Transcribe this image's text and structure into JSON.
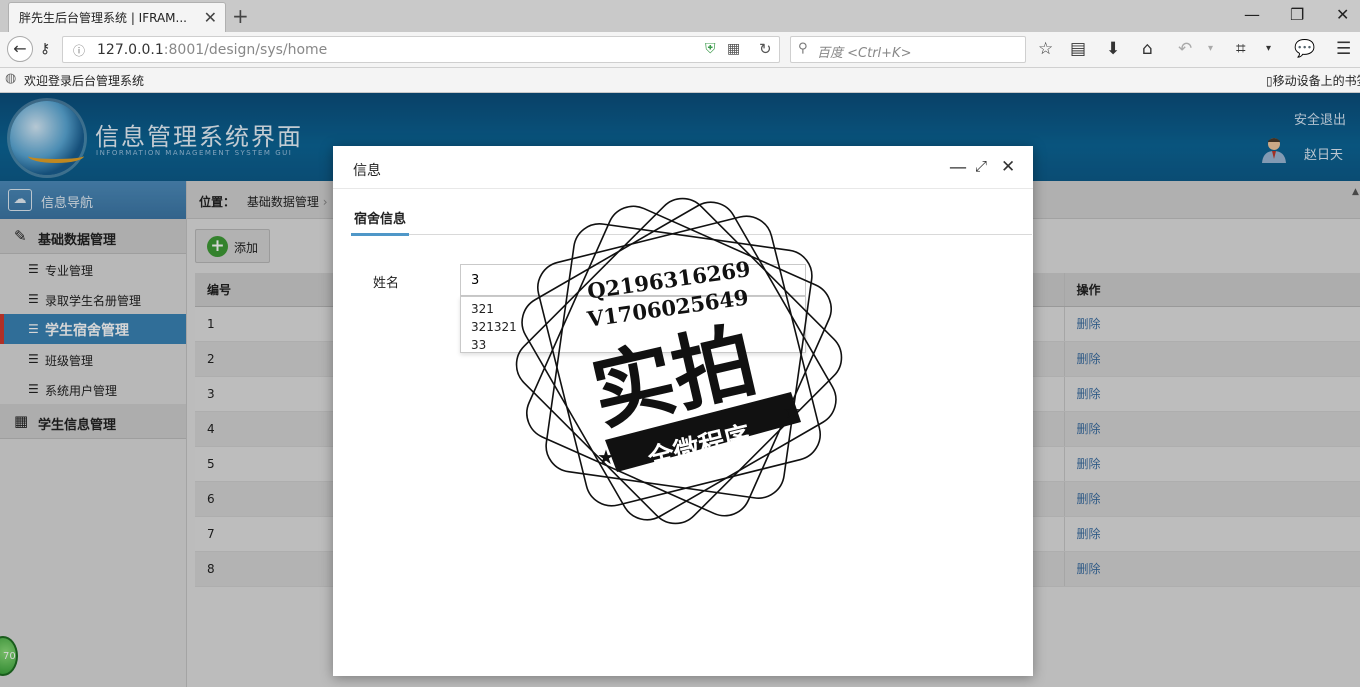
{
  "browser": {
    "tab_title": "胖先生后台管理系统 | IFRAM...",
    "url_host": "127.0.0.1",
    "url_rest": ":8001/design/sys/home",
    "search_placeholder": "百度 <Ctrl+K>",
    "bookmark": "欢迎登录后台管理系统",
    "mobile_bookmarks": "移动设备上的书签"
  },
  "header": {
    "title": "信息管理系统界面",
    "subtitle": "INFORMATION MANAGEMENT SYSTEM GUI",
    "logout": "安全退出",
    "user_name": "赵日天"
  },
  "sidebar": {
    "title": "信息导航",
    "groups": [
      {
        "label": "基础数据管理",
        "items": [
          {
            "label": "专业管理"
          },
          {
            "label": "录取学生名册管理"
          },
          {
            "label": "学生宿舍管理"
          },
          {
            "label": "班级管理"
          },
          {
            "label": "系统用户管理"
          }
        ]
      },
      {
        "label": "学生信息管理"
      }
    ],
    "badge": "70"
  },
  "main": {
    "breadcrumb_label": "位置：",
    "breadcrumb_item": "基础数据管理",
    "add_label": "添加",
    "table": {
      "col_id": "编号",
      "col_op": "操作",
      "rows": [
        {
          "id": "1",
          "op": "删除"
        },
        {
          "id": "2",
          "op": "删除"
        },
        {
          "id": "3",
          "op": "删除"
        },
        {
          "id": "4",
          "op": "删除"
        },
        {
          "id": "5",
          "op": "删除"
        },
        {
          "id": "6",
          "op": "删除"
        },
        {
          "id": "7",
          "op": "删除"
        },
        {
          "id": "8",
          "op": "删除"
        }
      ]
    }
  },
  "modal": {
    "title": "信息",
    "tab": "宿舍信息",
    "name_label": "姓名",
    "name_value": "3",
    "suggestions": [
      "321",
      "321321",
      "33"
    ]
  },
  "watermark": {
    "line1": "Q2196316269",
    "line2": "V1706025649",
    "big_text": "实拍",
    "banner": "全微程序"
  }
}
